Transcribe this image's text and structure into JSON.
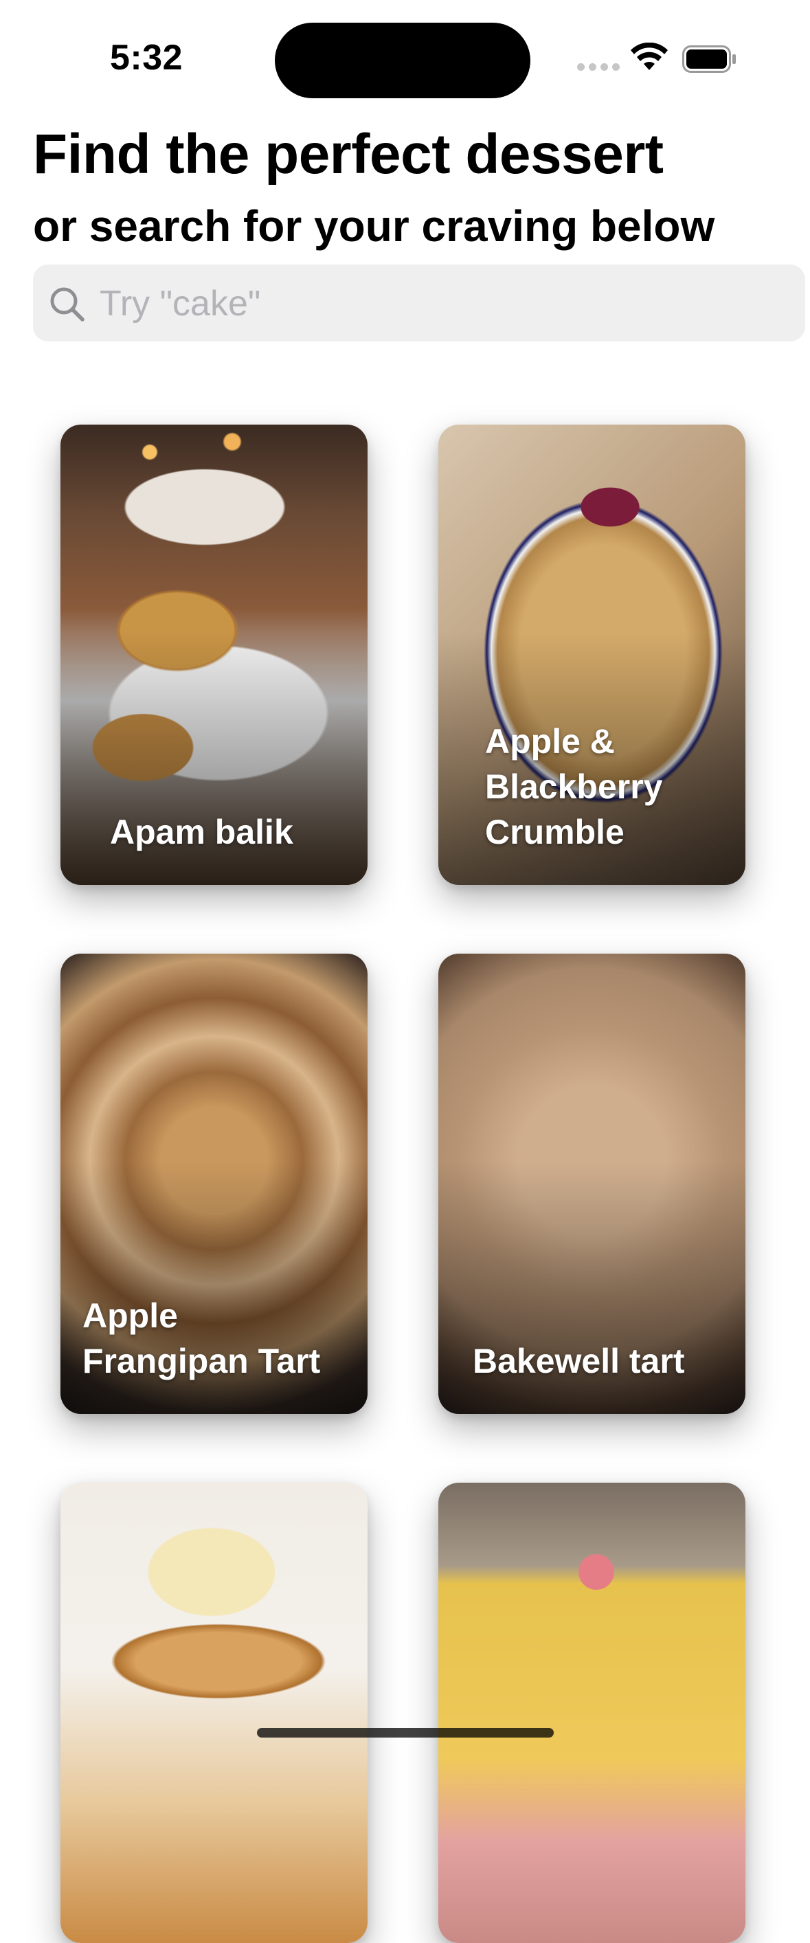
{
  "status_bar": {
    "time": "5:32"
  },
  "header": {
    "title": "Find the perfect dessert",
    "subtitle": "or search for your craving below"
  },
  "search": {
    "placeholder": "Try \"cake\"",
    "value": ""
  },
  "desserts": [
    {
      "name": "Apam balik"
    },
    {
      "name": "Apple & Blackberry Crumble"
    },
    {
      "name": "Apple Frangipan Tart"
    },
    {
      "name": "Bakewell tart"
    },
    {
      "name": ""
    },
    {
      "name": ""
    }
  ]
}
